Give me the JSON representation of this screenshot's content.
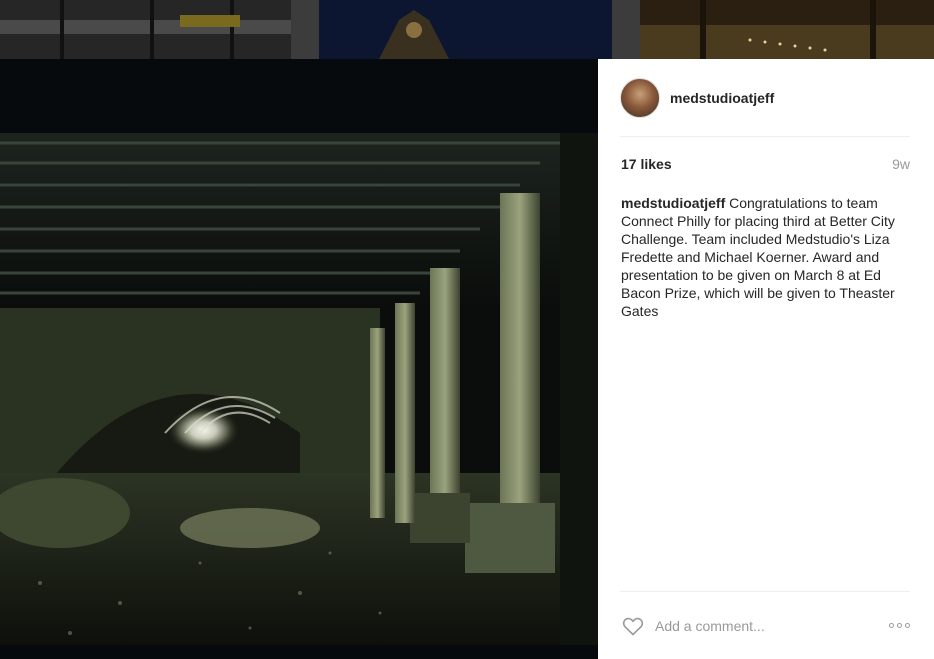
{
  "post": {
    "username": "medstudioatjeff",
    "likes": "17 likes",
    "age": "9w",
    "caption_user": "medstudioatjeff",
    "caption_text": "Congratulations to team Connect Philly for placing third at Better City Challenge. Team included Medstudio's Liza Fredette and Michael Koerner. Award and presentation to be given on March 8 at Ed Bacon Prize, which will be given to Theaster Gates"
  },
  "comment": {
    "placeholder": "Add a comment..."
  },
  "icons": {
    "like": "heart-icon",
    "more": "more-options-icon"
  },
  "colors": {
    "panel_bg": "#ffffff",
    "text": "#262626",
    "muted": "#999999"
  }
}
